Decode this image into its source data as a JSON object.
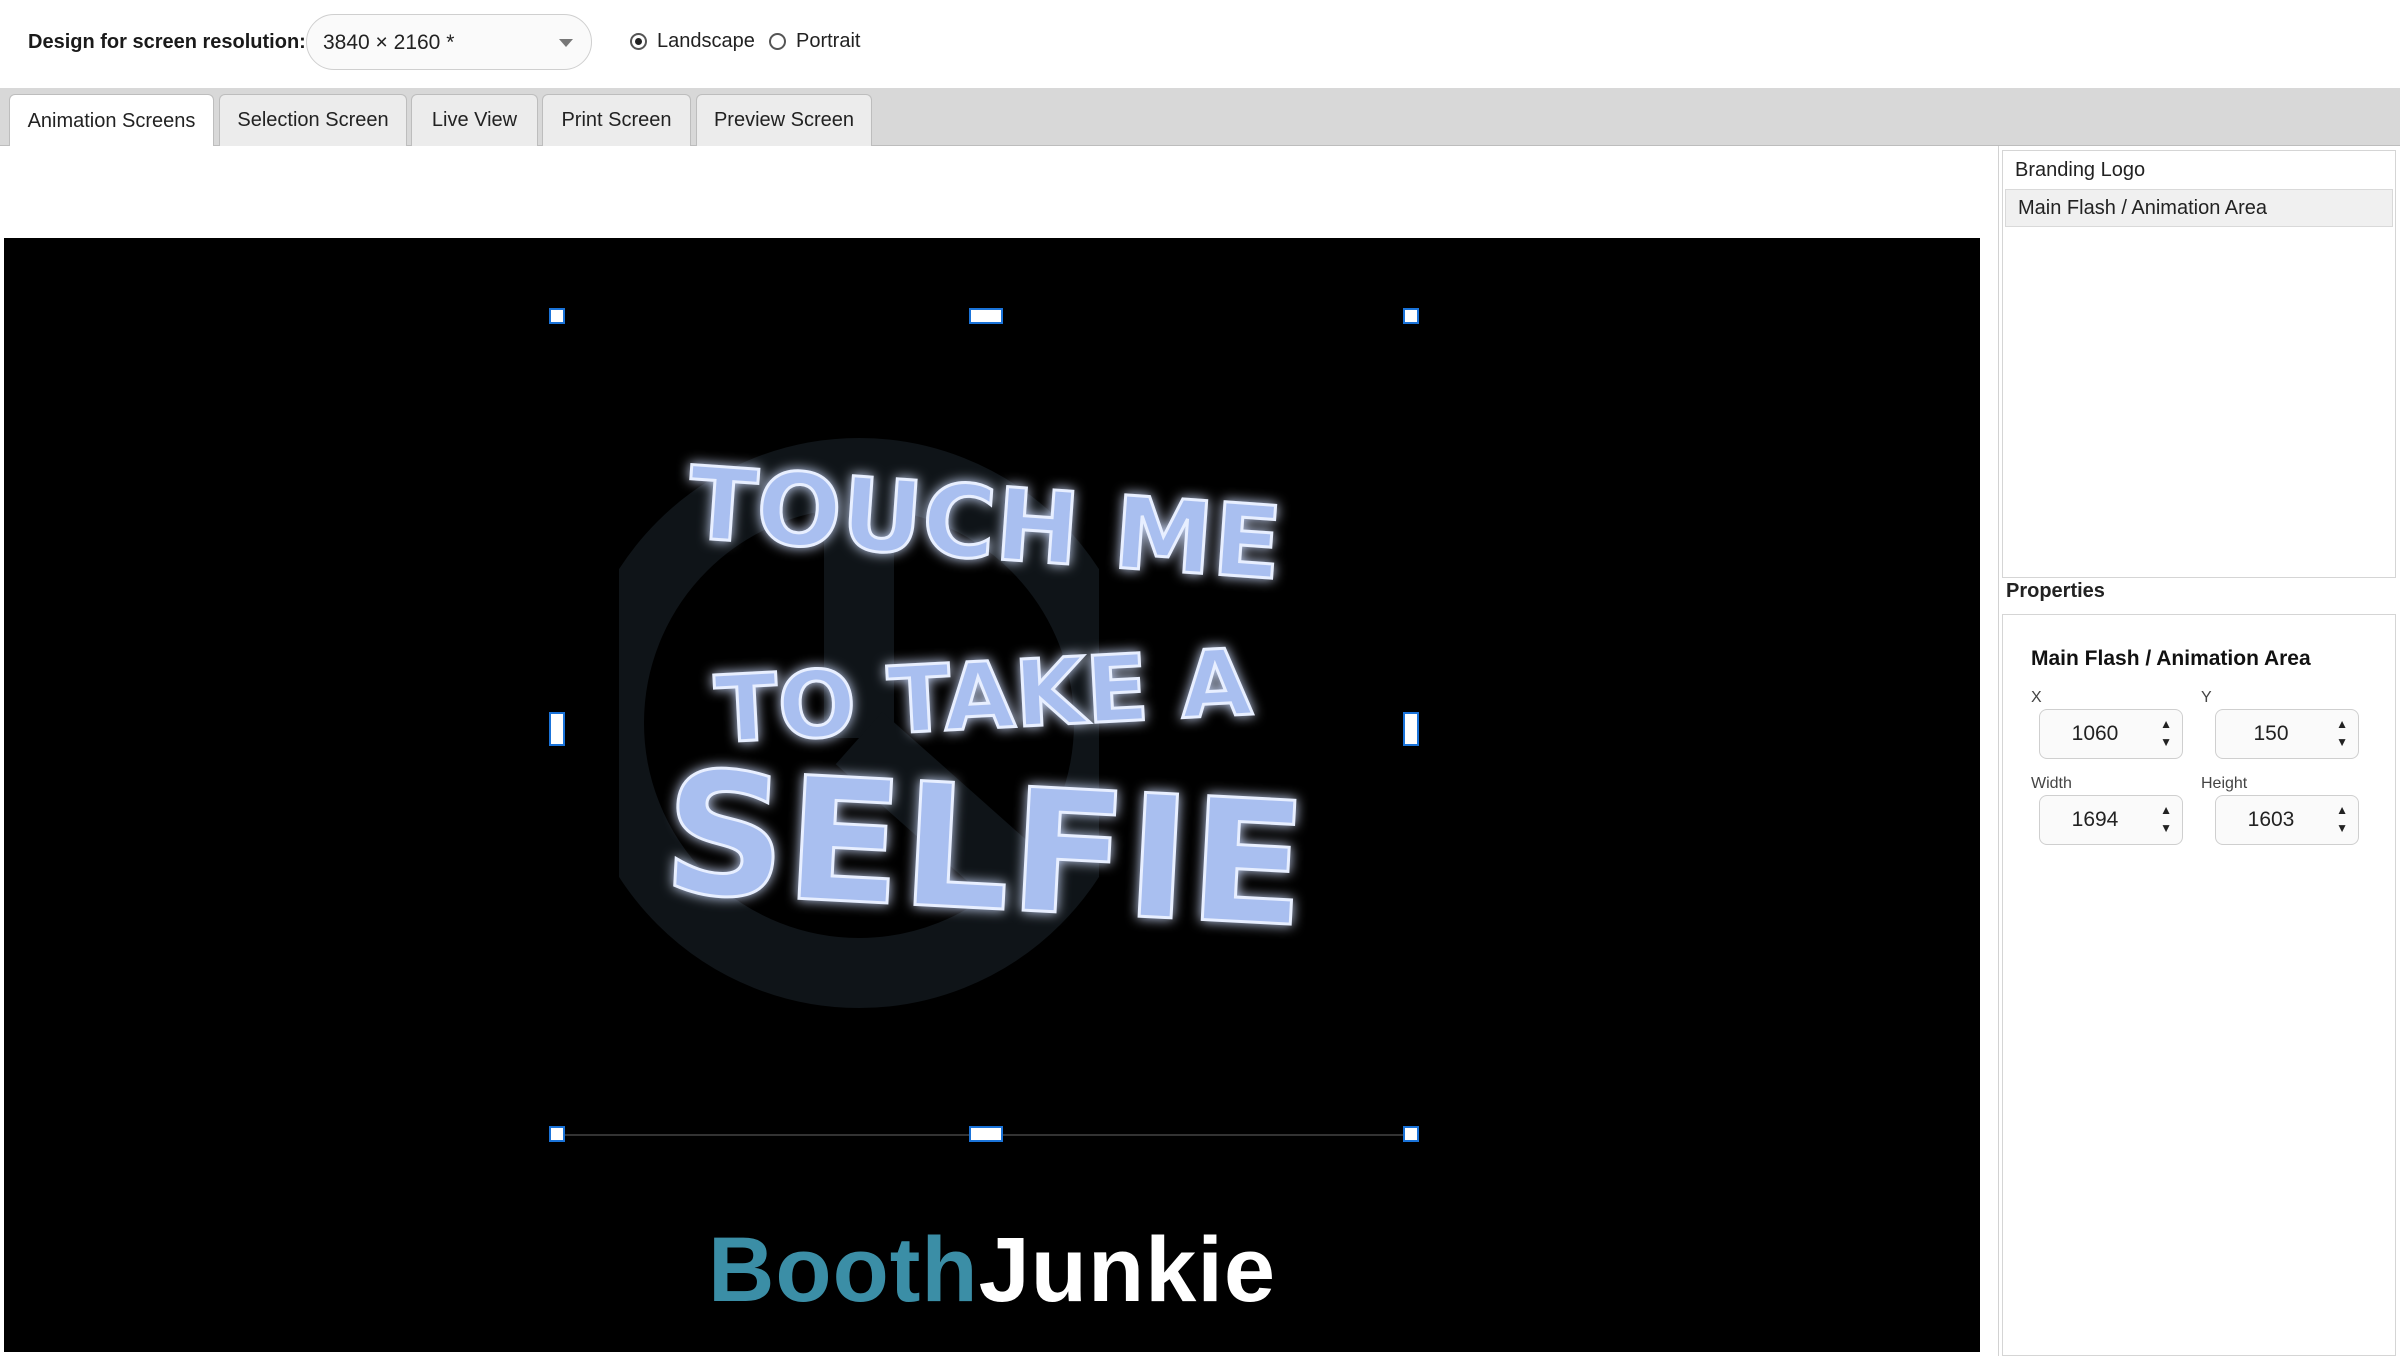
{
  "toolbar": {
    "resolution_label": "Design for screen resolution:",
    "resolution_value": "3840 × 2160 *",
    "orientation_landscape": "Landscape",
    "orientation_portrait": "Portrait",
    "selected_orientation": "Landscape"
  },
  "tabs": [
    {
      "label": "Animation Screens",
      "active": true
    },
    {
      "label": "Selection Screen",
      "active": false
    },
    {
      "label": "Live View",
      "active": false
    },
    {
      "label": "Print Screen",
      "active": false
    },
    {
      "label": "Preview Screen",
      "active": false
    }
  ],
  "canvas": {
    "animation_lines": [
      "TOUCH ME",
      "TO TAKE A",
      "SELFIE"
    ],
    "logo_part1": "Booth",
    "logo_part2": "Junkie"
  },
  "layers": [
    {
      "label": "Branding Logo",
      "selected": false
    },
    {
      "label": "Main Flash / Animation Area",
      "selected": true
    }
  ],
  "properties": {
    "title": "Properties",
    "element_name": "Main Flash / Animation Area",
    "x_label": "X",
    "x_value": "1060",
    "y_label": "Y",
    "y_value": "150",
    "width_label": "Width",
    "width_value": "1694",
    "height_label": "Height",
    "height_value": "1603"
  },
  "colors": {
    "stage_bg": "#000000",
    "logo_booth": "#3b8ea6",
    "logo_junkie": "#ffffff",
    "handle_border": "#1a73d9",
    "neon_fill": "#a9bff0"
  },
  "icons": {
    "dropdown": "chevron-down-icon",
    "spin_up": "arrow-up-icon",
    "spin_down": "arrow-down-icon"
  }
}
